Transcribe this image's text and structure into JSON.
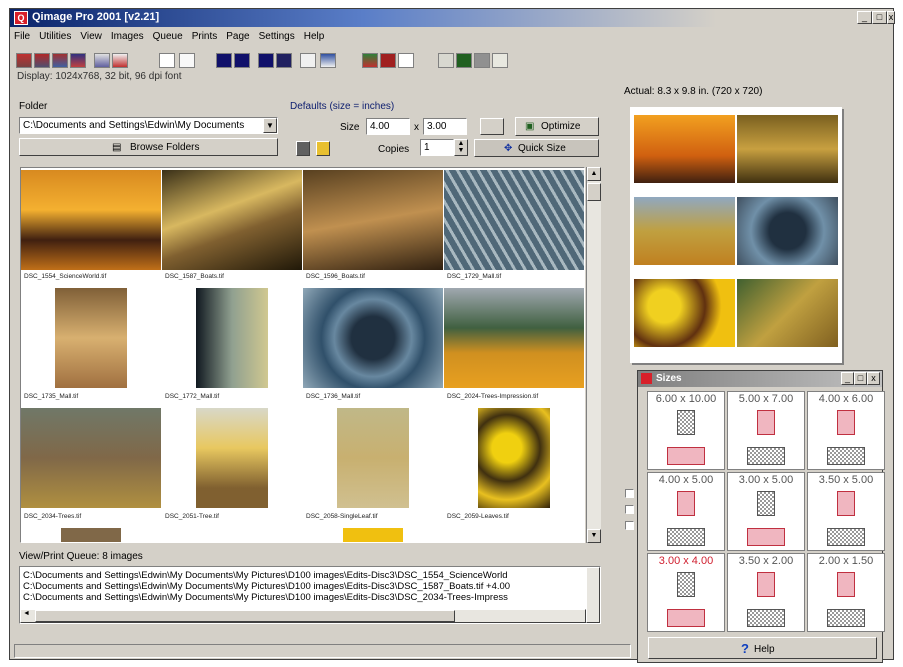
{
  "window": {
    "title": "Qimage Pro 2001 [v2.21]"
  },
  "menu": [
    "File",
    "Utilities",
    "View",
    "Images",
    "Queue",
    "Prints",
    "Page",
    "Settings",
    "Help"
  ],
  "display_info": "Display: 1024x768, 32 bit, 96 dpi font",
  "folder": {
    "label": "Folder",
    "path": "C:\\Documents and Settings\\Edwin\\My Documents",
    "browse_label": "Browse Folders"
  },
  "defaults": {
    "label": "Defaults (size = inches)",
    "size_label": "Size",
    "width": "4.00",
    "x_sep": "x",
    "height": "3.00",
    "copies_label": "Copies",
    "copies": "1",
    "optimize_label": "Optimize",
    "quicksize_label": "Quick Size"
  },
  "thumbnails": [
    {
      "caption": "DSC_1554_ScienceWorld.tif",
      "kind": "sunset"
    },
    {
      "caption": "DSC_1587_Boats.tif",
      "kind": "boats"
    },
    {
      "caption": "DSC_1596_Boats.tif",
      "kind": "boats2"
    },
    {
      "caption": "DSC_1729_Mall.tif",
      "kind": "mall"
    },
    {
      "caption": "DSC_1735_Mall.tif",
      "kind": "mall2"
    },
    {
      "caption": "DSC_1772_Mall.tif",
      "kind": "mall3"
    },
    {
      "caption": "DSC_1736_Mall.tif",
      "kind": "dome"
    },
    {
      "caption": "DSC_2024-Trees-Impression.tif",
      "kind": "trees"
    },
    {
      "caption": "DSC_2034-Trees.tif",
      "kind": "trees2"
    },
    {
      "caption": "DSC_2051-Tree.tif",
      "kind": "tree"
    },
    {
      "caption": "DSC_2058-SingleLeaf.tif",
      "kind": "leaf"
    },
    {
      "caption": "DSC_2059-Leaves.tif",
      "kind": "leaves"
    }
  ],
  "queue": {
    "label": "View/Print Queue: 8 images",
    "lines": [
      "C:\\Documents and Settings\\Edwin\\My Documents\\My Pictures\\D100 images\\Edits-Disc3\\DSC_1554_ScienceWorld",
      "C:\\Documents and Settings\\Edwin\\My Documents\\My Pictures\\D100 images\\Edits-Disc3\\DSC_1587_Boats.tif +4.00",
      "C:\\Documents and Settings\\Edwin\\My Documents\\My Pictures\\D100 images\\Edits-Disc3\\DSC_2034-Trees-Impress"
    ]
  },
  "preview": {
    "label": "Actual: 8.3 x 9.8 in. (720 x 720)"
  },
  "sizes_window": {
    "title": "Sizes",
    "sizes": [
      "6.00 x 10.00",
      "5.00 x 7.00",
      "4.00 x 6.00",
      "4.00 x 5.00",
      "3.00 x 5.00",
      "3.50 x 5.00",
      "3.00 x 4.00",
      "3.50 x 2.00",
      "2.00 x 1.50"
    ],
    "selected_size": "3.00 x 4.00",
    "help_label": "Help"
  },
  "colors": {
    "title_start": "#0a246a",
    "title_end": "#5a7ec8",
    "face": "#d4d0c8",
    "selected": "#d02030"
  }
}
